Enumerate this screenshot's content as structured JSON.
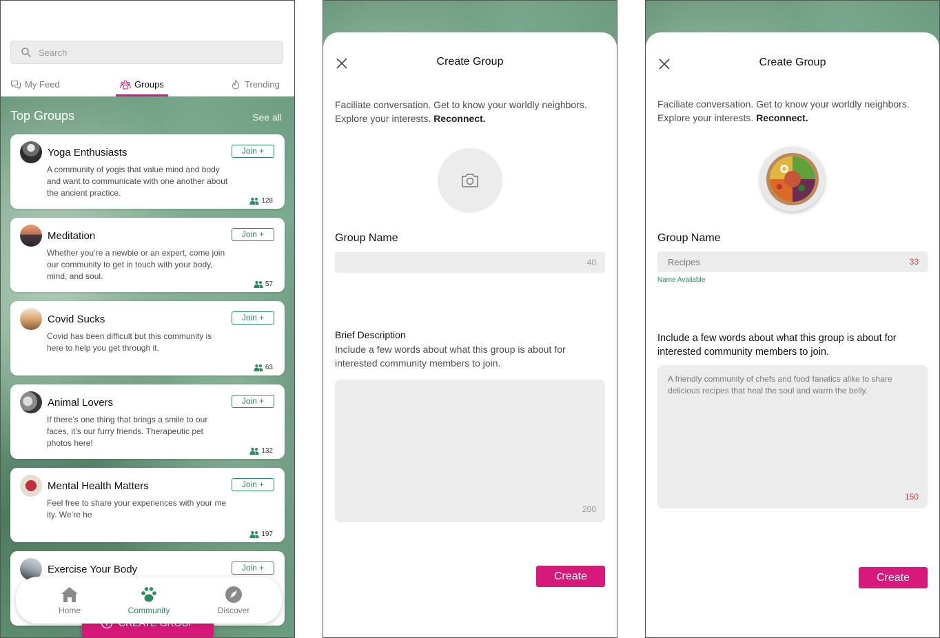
{
  "feed_screen": {
    "search": {
      "placeholder": "Search"
    },
    "tabs": [
      {
        "label": "My Feed",
        "icon": "chat-bubbles-icon"
      },
      {
        "label": "Groups",
        "icon": "people-group-icon",
        "active": true
      },
      {
        "label": "Trending",
        "icon": "flame-icon"
      }
    ],
    "section_title": "Top Groups",
    "see_all": "See all",
    "groups": [
      {
        "name": "Yoga Enthusiasts",
        "join": "Join +",
        "description": "A community of yogis that value mind and body and want to communicate with one another about the ancient practice.",
        "members": "128"
      },
      {
        "name": "Meditation",
        "join": "Join +",
        "description": "Whether you’re a newbie or an expert, come join our community to get in touch with your body, mind, and soul.",
        "members": "57"
      },
      {
        "name": "Covid Sucks",
        "join": "Join +",
        "description": "Covid has been difficult but this community is here to help you get through it.",
        "members": "63"
      },
      {
        "name": "Animal Lovers",
        "join": "Join +",
        "description": "If there’s one thing that brings a smile to our faces, it’s our furry friends. Therapeutic pet photos here!",
        "members": "132"
      },
      {
        "name": "Mental Health Matters",
        "join": "Join +",
        "description": "Feel free to share your experiences with your me                                    ity. We’re he",
        "members": "197"
      },
      {
        "name": "Exercise Your Body",
        "join": "Join +",
        "description": "",
        "members": ""
      }
    ],
    "create_group_button": "CREATE GROUP",
    "bottom_nav": [
      {
        "label": "Home",
        "icon": "home-icon"
      },
      {
        "label": "Community",
        "icon": "paw-icon",
        "active": true
      },
      {
        "label": "Discover",
        "icon": "compass-icon"
      }
    ]
  },
  "create_empty": {
    "title": "Create Group",
    "intro": "Faciliate conversation. Get to know your worldly neighbors. Explore your interests.",
    "intro_bold": "Reconnect.",
    "group_name_label": "Group Name",
    "group_name_value": "",
    "group_name_count": "40",
    "description_label": "Brief Description",
    "description_help": "Include a few words about what this group is about for interested community members to join.",
    "description_value": "",
    "description_count": "200",
    "create_button": "Create"
  },
  "create_filled": {
    "title": "Create Group",
    "intro": "Faciliate conversation. Get to know your worldly neighbors. Explore your interests.",
    "intro_bold": "Reconnect.",
    "group_name_label": "Group Name",
    "group_name_value": "Recipes",
    "group_name_count": "33",
    "name_status": "Name Available",
    "description_help": "Include a few words about what this group is about for interested community members to join.",
    "description_value": "A friendly community of chefs and food fanatics alike to share delicious recipes that heal the soul and warm the belly.",
    "description_count": "150",
    "create_button": "Create"
  },
  "colors": {
    "accent": "#d6197b",
    "green": "#2e8b5a",
    "counter_red": "#e0443c"
  }
}
